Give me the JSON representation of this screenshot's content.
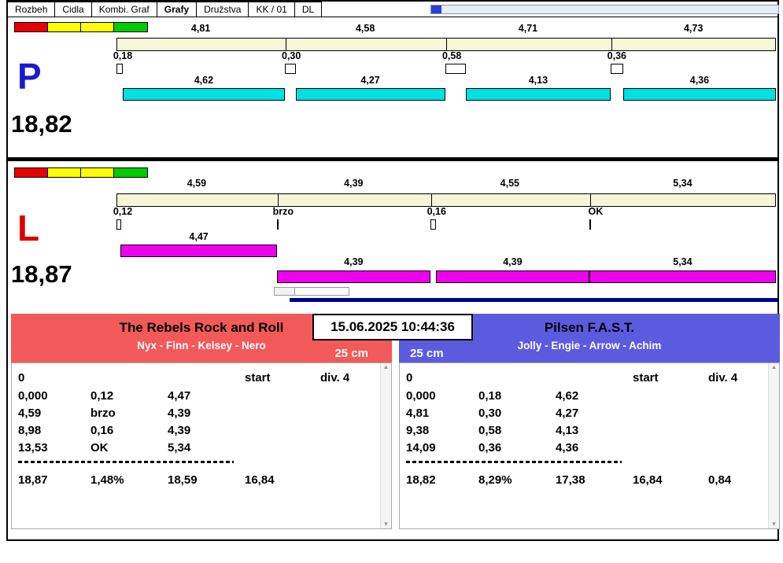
{
  "tabs": [
    "Rozbeh",
    "Cidla",
    "Kombi. Graf",
    "Grafy",
    "Družstva",
    "KK / 01",
    "DL"
  ],
  "selected_tab": "Grafy",
  "datetime": "15.06.2025 10:44:36",
  "status_squares": [
    "#e60000",
    "#ffff00",
    "#ffff00",
    "#00cc00"
  ],
  "colors": {
    "split_bar": "#f6f6d8",
    "right_lane_bar": "#00e0e0",
    "left_lane_bar": "#ee00ee",
    "timeline": "#00008b"
  },
  "panels": [
    {
      "id": "P",
      "letter": "P",
      "letter_color": "#1a1acd",
      "total": "18,82",
      "bar_color": "#00e0e0",
      "segments": [
        {
          "split": "4,81",
          "change": "0,18",
          "dog": "4,62",
          "lane": "top"
        },
        {
          "split": "4,58",
          "change": "0,30",
          "dog": "4,27",
          "lane": "top"
        },
        {
          "split": "4,71",
          "change": "0,58",
          "dog": "4,13",
          "lane": "top"
        },
        {
          "split": "4,73",
          "change": "0,36",
          "dog": "4,36",
          "lane": "top"
        }
      ]
    },
    {
      "id": "L",
      "letter": "L",
      "letter_color": "#dd0000",
      "total": "18,87",
      "bar_color": "#ee00ee",
      "segments": [
        {
          "split": "4,59",
          "change": "0,12",
          "dog": "4,47",
          "lane": "top"
        },
        {
          "split": "4,39",
          "change": "brzo",
          "dog": "4,39",
          "lane": "bottom"
        },
        {
          "split": "4,55",
          "change": "0,16",
          "dog": "4,39",
          "lane": "bottom"
        },
        {
          "split": "5,34",
          "change": "OK",
          "dog": "5,34",
          "lane": "bottom"
        }
      ]
    }
  ],
  "teams": [
    {
      "name": "The Rebels Rock and Roll",
      "members": "Nyx - Finn - Kelsey - Nero",
      "height": "25 cm",
      "header_color": "#f25a5a",
      "height_side": "right",
      "first_row": {
        "zero": "0",
        "start": "start",
        "division": "div. 4"
      },
      "rows": [
        [
          "0,000",
          "0,12",
          "4,47"
        ],
        [
          "4,59",
          "brzo",
          "4,39"
        ],
        [
          "8,98",
          "0,16",
          "4,39"
        ],
        [
          "13,53",
          "OK",
          "5,34"
        ]
      ],
      "totals": [
        "18,87",
        "1,48%",
        "18,59",
        "16,84"
      ]
    },
    {
      "name": "Pilsen F.A.S.T.",
      "members": "Jolly - Engie - Arrow - Achim",
      "height": "25 cm",
      "header_color": "#5b5be0",
      "height_side": "left",
      "first_row": {
        "zero": "0",
        "start": "start",
        "division": "div. 4"
      },
      "rows": [
        [
          "0,000",
          "0,18",
          "4,62"
        ],
        [
          "4,81",
          "0,30",
          "4,27"
        ],
        [
          "9,38",
          "0,58",
          "4,13"
        ],
        [
          "14,09",
          "0,36",
          "4,36"
        ]
      ],
      "totals": [
        "18,82",
        "8,29%",
        "17,38",
        "16,84",
        "0,84"
      ]
    }
  ]
}
